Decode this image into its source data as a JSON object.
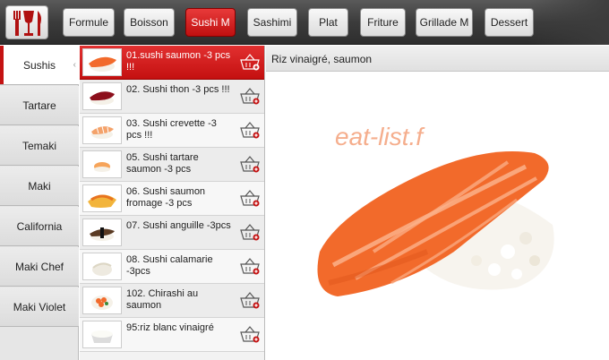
{
  "app": {
    "logo_icon": "fork-glass-knife-logo"
  },
  "categories": [
    {
      "label": "Formule"
    },
    {
      "label": "Boisson"
    },
    {
      "label": "Sushi M"
    },
    {
      "label": "Sashimi"
    },
    {
      "label": "Plat"
    },
    {
      "label": "Friture"
    },
    {
      "label": "Grillade M"
    },
    {
      "label": "Dessert"
    }
  ],
  "active_category": "Sushi M",
  "sidebar": {
    "items": [
      {
        "label": "Sushis"
      },
      {
        "label": "Tartare"
      },
      {
        "label": "Temaki"
      },
      {
        "label": "Maki"
      },
      {
        "label": "California"
      },
      {
        "label": "Maki Chef"
      },
      {
        "label": "Maki Violet"
      }
    ],
    "active": "Sushis"
  },
  "products": [
    {
      "name": "01.sushi saumon -3 pcs !!!",
      "thumb": "salmon-nigiri"
    },
    {
      "name": "02. Sushi thon -3 pcs !!!",
      "thumb": "tuna-nigiri"
    },
    {
      "name": "03. Sushi crevette -3 pcs !!!",
      "thumb": "shrimp-nigiri"
    },
    {
      "name": "05. Sushi tartare saumon -3 pcs",
      "thumb": "salmon-tartare-sushi"
    },
    {
      "name": "06. Sushi saumon fromage -3 pcs",
      "thumb": "salmon-cheese-sushi"
    },
    {
      "name": "07. Sushi anguille -3pcs",
      "thumb": "eel-nigiri"
    },
    {
      "name": "08. Sushi calamarie -3pcs",
      "thumb": "squid-nigiri"
    },
    {
      "name": "102. Chirashi au saumon",
      "thumb": "chirashi-bowl"
    },
    {
      "name": "95:riz blanc vinaigré",
      "thumb": "rice-bowl"
    }
  ],
  "active_product_index": 0,
  "detail": {
    "description": "Riz vinaigré, saumon",
    "watermark": "eat-list.f",
    "image": "salmon-nigiri-photo"
  },
  "colors": {
    "accent": "#c41212",
    "salmon": "#f26a2b"
  },
  "icons": {
    "add_to_basket": "basket-plus-icon"
  }
}
